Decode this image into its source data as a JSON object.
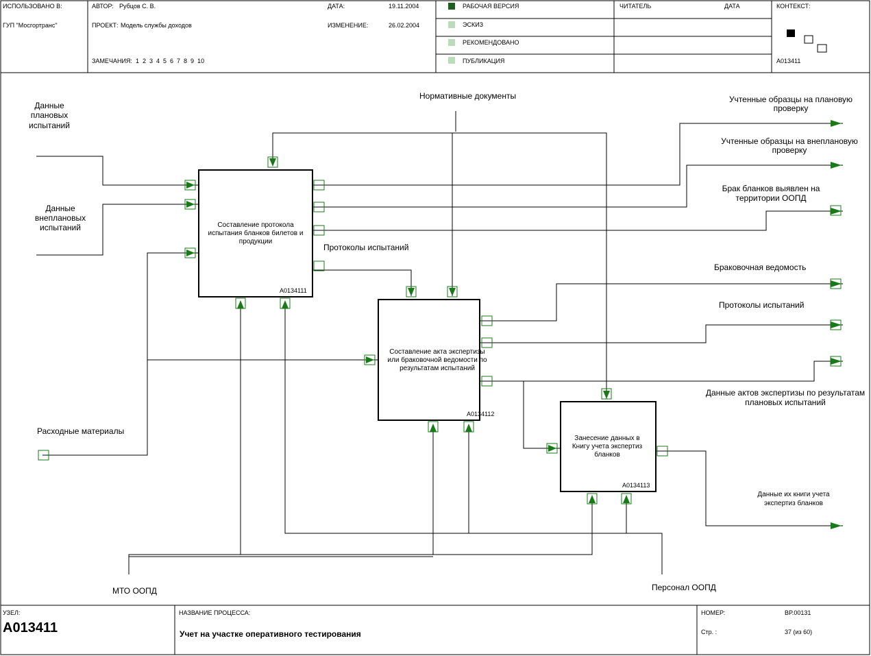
{
  "header": {
    "used_at_label": "ИСПОЛЬЗОВАНО В:",
    "used_at_value": "ГУП \"Мосгортранс\"",
    "author_label": "АВТОР:",
    "author_value": "Рубцов С. В.",
    "project_label": "ПРОЕКТ:",
    "project_value": "Модель службы доходов",
    "date_label": "ДАТА:",
    "date_value": "19.11.2004",
    "change_label": "ИЗМЕНЕНИЕ:",
    "change_value": "26.02.2004",
    "notes_label": "ЗАМЕЧАНИЯ:",
    "notes_numbers": "1  2  3  4  5  6  7  8  9  10",
    "status_items": [
      "РАБОЧАЯ ВЕРСИЯ",
      "ЭСКИЗ",
      "РЕКОМЕНДОВАНО",
      "ПУБЛИКАЦИЯ"
    ],
    "reader_label": "ЧИТАТЕЛЬ",
    "reader_date_label": "ДАТА",
    "context_label": "КОНТЕКСТ:",
    "context_code": "A013411"
  },
  "boxes": [
    {
      "lines": [
        "Составление протокола",
        "испытания бланков билетов и",
        "продукции"
      ],
      "code": "A0134111"
    },
    {
      "lines": [
        "Составление акта экспертизы",
        "или браковочной ведомости по",
        "результатам испытаний"
      ],
      "code": "A0134112"
    },
    {
      "lines": [
        "Занесение данных в",
        "Книгу учета экспертиз",
        "бланков"
      ],
      "code": "A0134113"
    }
  ],
  "labels": {
    "planned_data": [
      "Данные",
      "плановых",
      "испытаний"
    ],
    "unplanned_data": [
      "Данные",
      "внеплановых",
      "испытаний"
    ],
    "consumables": "Расходные материалы",
    "mto": "МТО ООПД",
    "staff": "Персонал ООПД",
    "normative": "Нормативные документы",
    "protocols_mid": "Протоколы испытаний",
    "out_planned": [
      "Учтенные образцы на плановую",
      "проверку"
    ],
    "out_unplanned": [
      "Учтенные образцы на внеплановую",
      "проверку"
    ],
    "out_defect": [
      "Брак бланков выявлен на",
      "территории ООПД"
    ],
    "out_reject": "Браковочная ведомость",
    "out_protocols": "Протоколы испытаний",
    "out_expertise": [
      "Данные актов экспертизы по результатам",
      "плановых испытаний"
    ],
    "out_book": [
      "Данные их книги учета",
      "экспертиз бланков"
    ]
  },
  "footer": {
    "node_label": "УЗЕЛ:",
    "node_value": "A013411",
    "process_label": "НАЗВАНИЕ ПРОЦЕССА:",
    "process_value": "Учет на участке оперативного тестирования",
    "number_label": "НОМЕР:",
    "number_value": "BP.00131",
    "page_label": "Стр. :",
    "page_value": "37 (из 60)"
  },
  "colors": {
    "arrow": "#1a7a1a",
    "status_dark": "#1e5e1e",
    "status_light": "#b8ddb8"
  }
}
